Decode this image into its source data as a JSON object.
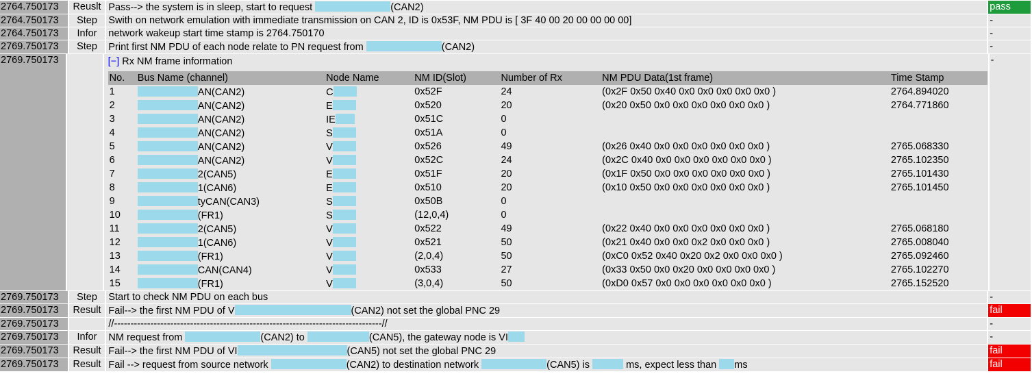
{
  "colors": {
    "pass": "#1e9c3c",
    "fail": "#f20000",
    "redaction": "#9cd9eb",
    "timestamp_bg": "#b0b0b0",
    "row_bg": "#e6e6e6"
  },
  "rows": [
    {
      "ts": "2764.750173",
      "type": "Reuslt",
      "parts": [
        "Pass--> the system is in sleep, start to request ",
        {
          "r": 110
        },
        "(CAN2)"
      ],
      "status": "pass"
    },
    {
      "ts": "2764.750173",
      "type": "Step",
      "parts": [
        "Swith on network emulation with immediate transmission on CAN 2, ID is 0x53F, NM PDU is [ 3F 40 00 20 00 00 00 00]"
      ],
      "status": "-"
    },
    {
      "ts": "2764.750173",
      "type": "Infor",
      "parts": [
        "network wakeup start time stamp is 2764.750170"
      ],
      "status": "-"
    },
    {
      "ts": "2769.750173",
      "type": "Step",
      "parts": [
        "Print first NM PDU of each node relate to PN request from ",
        {
          "r": 110
        },
        "(CAN2)"
      ],
      "status": "-"
    },
    {
      "ts": "2769.750173",
      "type": "",
      "table": true,
      "status": "-"
    },
    {
      "ts": "2769.750173",
      "type": "Step",
      "parts": [
        "Start to check NM PDU on each bus"
      ],
      "status": "-"
    },
    {
      "ts": "2769.750173",
      "type": "Result",
      "parts": [
        "Fail--> the first NM PDU of V",
        {
          "r": 170
        },
        "(CAN2) not set the global PNC 29"
      ],
      "status": "fail"
    },
    {
      "ts": "2769.750173",
      "type": "",
      "parts": [
        "//---------------------------------------------------------------------------------//"
      ],
      "status": "-"
    },
    {
      "ts": "2769.750173",
      "type": "Infor",
      "parts": [
        "NM request from ",
        {
          "r": 110
        },
        "(CAN2) to ",
        {
          "r": 90
        },
        "(CAN5), the gateway node is VI",
        {
          "r": 24
        }
      ],
      "status": "-"
    },
    {
      "ts": "2769.750173",
      "type": "Result",
      "parts": [
        "Fail--> the first NM PDU of VI",
        {
          "r": 160
        },
        "(CAN5) not set the global PNC 29"
      ],
      "status": "fail"
    },
    {
      "ts": "2769.750173",
      "type": "Result",
      "parts": [
        "Fail --> request from source network ",
        {
          "r": 110
        },
        "(CAN2) to destination network ",
        {
          "r": 95
        },
        "(CAN5) is ",
        {
          "r": 45
        },
        " ms, expect less than ",
        {
          "r": 22
        },
        "ms"
      ],
      "status": "fail"
    }
  ],
  "rx": {
    "toggle": "[−]",
    "title": "Rx NM frame information",
    "headers": [
      "No.",
      "Bus Name (channel)",
      "Node Name",
      "NM ID(Slot)",
      "Number of Rx",
      "NM PDU Data(1st frame)",
      "Time Stamp"
    ],
    "rows": [
      [
        "1",
        "AN(CAN2)",
        "C",
        "0x52F",
        "24",
        "(0x2F 0x50 0x40 0x0 0x0 0x0 0x0 0x0 )",
        "2764.894020"
      ],
      [
        "2",
        "AN(CAN2)",
        "E",
        "0x520",
        "20",
        "(0x20 0x50 0x0 0x0 0x0 0x0 0x0 0x0 )",
        "2764.771860"
      ],
      [
        "3",
        "AN(CAN2)",
        "IE",
        "0x51C",
        "0",
        "",
        ""
      ],
      [
        "4",
        "AN(CAN2)",
        "S",
        "0x51A",
        "0",
        "",
        ""
      ],
      [
        "5",
        "AN(CAN2)",
        "V",
        "0x526",
        "49",
        "(0x26 0x40 0x0 0x0 0x0 0x0 0x0 0x0 )",
        "2765.068330"
      ],
      [
        "6",
        "AN(CAN2)",
        "V",
        "0x52C",
        "24",
        "(0x2C 0x40 0x0 0x0 0x0 0x0 0x0 0x0 )",
        "2765.102350"
      ],
      [
        "7",
        "2(CAN5)",
        "E",
        "0x51F",
        "20",
        "(0x1F 0x50 0x0 0x0 0x0 0x0 0x0 0x0 )",
        "2765.101430"
      ],
      [
        "8",
        "1(CAN6)",
        "E",
        "0x510",
        "20",
        "(0x10 0x50 0x0 0x0 0x0 0x0 0x0 0x0 )",
        "2765.101450"
      ],
      [
        "9",
        "tyCAN(CAN3)",
        "S",
        "0x50B",
        "0",
        "",
        ""
      ],
      [
        "10",
        "(FR1)",
        "S",
        "(12,0,4)",
        "0",
        "",
        ""
      ],
      [
        "11",
        "2(CAN5)",
        "V",
        "0x522",
        "49",
        "(0x22 0x40 0x0 0x0 0x0 0x0 0x0 0x0 )",
        "2765.068180"
      ],
      [
        "12",
        "1(CAN6)",
        "V",
        "0x521",
        "50",
        "(0x21 0x40 0x0 0x0 0x2 0x0 0x0 0x0 )",
        "2765.008040"
      ],
      [
        "13",
        "(FR1)",
        "V",
        "(2,0,4)",
        "50",
        "(0xC0 0x52 0x40 0x20 0x2 0x0 0x0 0x0 )",
        "2765.092460"
      ],
      [
        "14",
        "CAN(CAN4)",
        "V",
        "0x533",
        "27",
        "(0x33 0x50 0x0 0x20 0x0 0x0 0x0 0x0 )",
        "2765.102270"
      ],
      [
        "15",
        "(FR1)",
        "V",
        "(3,0,4)",
        "50",
        "(0xD0 0x57 0x0 0x0 0x0 0x0 0x0 0x0 )",
        "2765.152520"
      ]
    ]
  }
}
